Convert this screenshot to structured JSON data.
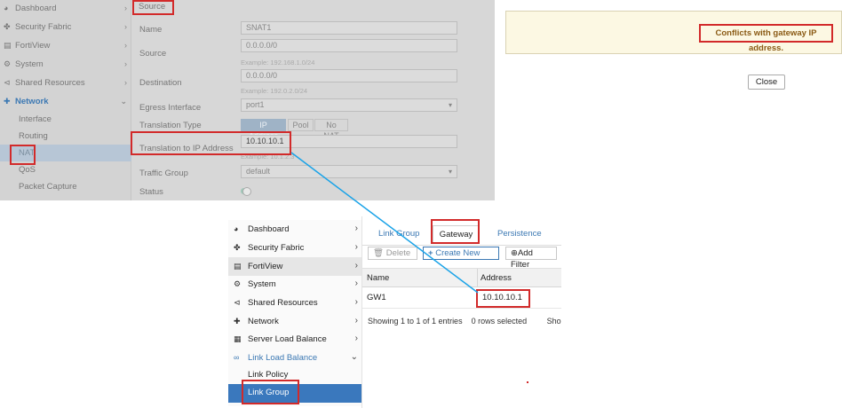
{
  "top_sidebar": {
    "items": [
      {
        "label": "Dashboard",
        "icon": "dashboard-icon"
      },
      {
        "label": "Security Fabric",
        "icon": "security-fabric-icon"
      },
      {
        "label": "FortiView",
        "icon": "chart-icon"
      },
      {
        "label": "System",
        "icon": "gear-icon"
      },
      {
        "label": "Shared Resources",
        "icon": "share-icon"
      },
      {
        "label": "Network",
        "icon": "network-icon"
      }
    ],
    "sub_items": [
      "Interface",
      "Routing",
      "NAT",
      "QoS",
      "Packet Capture"
    ]
  },
  "snat_form": {
    "section_title": "Source",
    "name_label": "Name",
    "name_value": "SNAT1",
    "source_label": "Source",
    "source_value": "0.0.0.0/0",
    "source_hint": "Example: 192.168.1.0/24",
    "destination_label": "Destination",
    "destination_value": "0.0.0.0/0",
    "destination_hint": "Example: 192.0.2.0/24",
    "egress_label": "Egress Interface",
    "egress_value": "port1",
    "translation_type_label": "Translation Type",
    "translation_types": [
      "IP Address",
      "Pool",
      "No NAT"
    ],
    "translation_ip_label": "Translation to IP Address",
    "translation_ip_value": "10.10.10.1",
    "translation_ip_hint": "Example: 10.1.2.3",
    "traffic_group_label": "Traffic Group",
    "traffic_group_value": "default",
    "status_label": "Status"
  },
  "dialog": {
    "message": "Conflicts with gateway IP address.",
    "close_label": "Close"
  },
  "bottom_sidebar": {
    "items": [
      {
        "label": "Dashboard",
        "icon": "dashboard-icon"
      },
      {
        "label": "Security Fabric",
        "icon": "security-fabric-icon"
      },
      {
        "label": "FortiView",
        "icon": "chart-icon"
      },
      {
        "label": "System",
        "icon": "gear-icon"
      },
      {
        "label": "Shared Resources",
        "icon": "share-icon"
      },
      {
        "label": "Network",
        "icon": "network-icon"
      },
      {
        "label": "Server Load Balance",
        "icon": "server-load-balance-icon"
      },
      {
        "label": "Link Load Balance",
        "icon": "link-icon"
      }
    ],
    "sub_items": [
      "Link Policy",
      "Link Group"
    ]
  },
  "link_group_page": {
    "tabs": [
      "Link Group",
      "Gateway",
      "Persistence"
    ],
    "delete_label": "Delete",
    "create_label": "Create New",
    "filter_label": "Add Filter",
    "columns": [
      "Name",
      "Address"
    ],
    "rows": [
      {
        "name": "GW1",
        "address": "10.10.10.1"
      }
    ],
    "footer_entries": "Showing 1 to 1 of 1 entries",
    "footer_selected": "0 rows selected",
    "footer_cut": "Sho"
  },
  "colors": {
    "accent": "#3a78bd",
    "annotation_red": "#d22a2a",
    "connector_blue": "#1aa3e8",
    "warning_bg": "#fcf8e3"
  }
}
